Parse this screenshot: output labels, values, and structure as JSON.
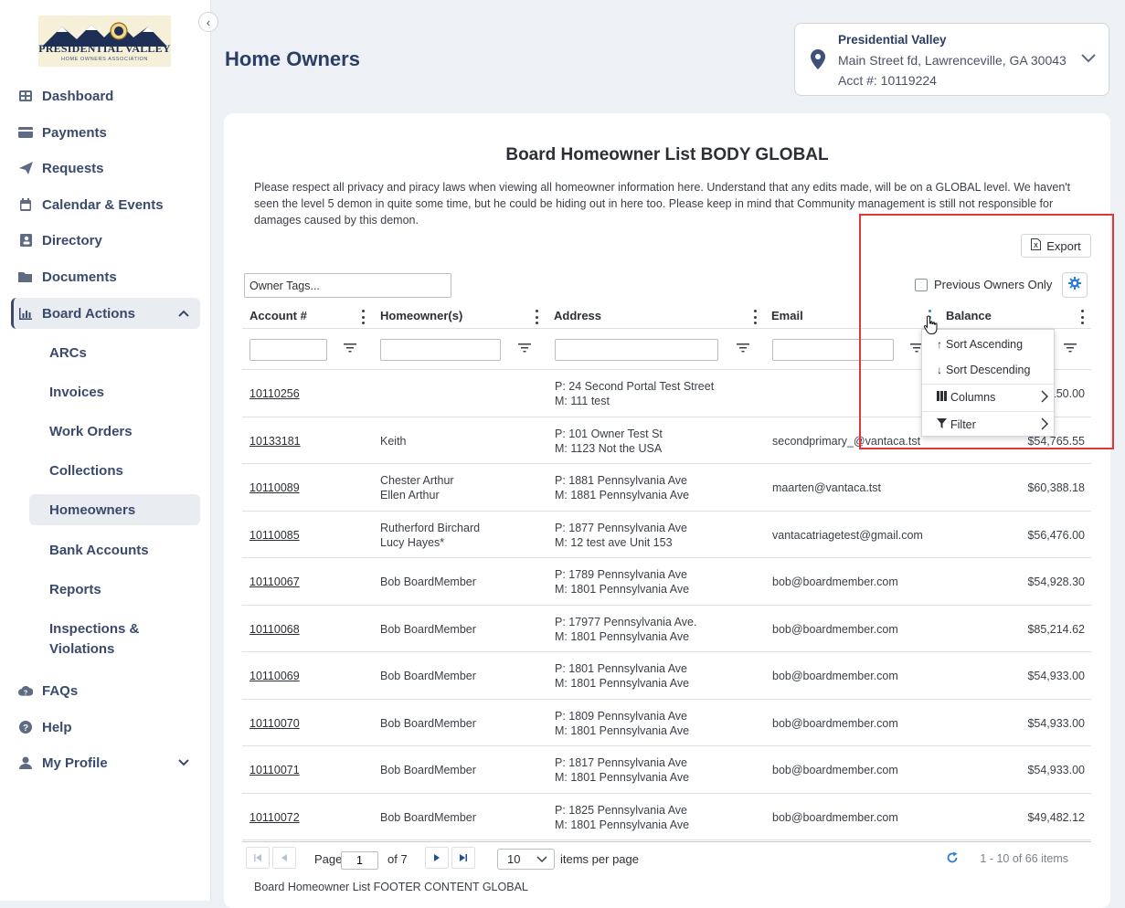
{
  "logo": {
    "title": "PRESIDENTIAL VALLEY",
    "subtitle": "HOME OWNERS ASSOCIATION"
  },
  "sidebar": {
    "items": [
      {
        "label": "Dashboard",
        "icon": "dashboard-icon"
      },
      {
        "label": "Payments",
        "icon": "credit-card-icon"
      },
      {
        "label": "Requests",
        "icon": "paper-plane-icon"
      },
      {
        "label": "Calendar & Events",
        "icon": "calendar-icon"
      },
      {
        "label": "Directory",
        "icon": "address-book-icon"
      },
      {
        "label": "Documents",
        "icon": "folder-icon"
      },
      {
        "label": "Board Actions",
        "icon": "bar-chart-icon"
      }
    ],
    "board_sub": [
      {
        "label": "ARCs"
      },
      {
        "label": "Invoices"
      },
      {
        "label": "Work Orders"
      },
      {
        "label": "Collections"
      },
      {
        "label": "Homeowners"
      },
      {
        "label": "Bank Accounts"
      },
      {
        "label": "Reports"
      },
      {
        "label": "Inspections & Violations"
      }
    ],
    "bottom": [
      {
        "label": "FAQs",
        "icon": "cloud-question-icon"
      },
      {
        "label": "Help",
        "icon": "help-circle-icon"
      },
      {
        "label": "My Profile",
        "icon": "user-icon"
      }
    ]
  },
  "header": {
    "title": "Home Owners",
    "assoc_name": "Presidential Valley",
    "assoc_address": "Main Street fd, Lawrenceville, GA 30043",
    "assoc_acct": "Acct #: 10119224"
  },
  "main": {
    "title": "Board Homeowner List BODY GLOBAL",
    "notice": "Please respect all privacy and piracy laws when viewing all homeowner information here. Understand that any edits made, will be on a GLOBAL level. We haven't seen the level 5 demon in quite some time, but he could be hiding out in here too. Please keep in mind that Community management is still not responsible for damages caused by this demon.",
    "export_label": "Export",
    "owner_tags_placeholder": "Owner Tags...",
    "prev_owners_label": "Previous Owners Only",
    "columns": [
      "Account #",
      "Homeowner(s)",
      "Address",
      "Email",
      "Balance"
    ],
    "rows": [
      {
        "acct": "10110256",
        "owner1": "",
        "owner2": "",
        "addr_p": "P: 24 Second Portal Test Street",
        "addr_m": "M: 111 test",
        "email": "",
        "balance": "$150.00"
      },
      {
        "acct": "10133181",
        "owner1": "Keith",
        "owner2": "",
        "addr_p": "P: 101 Owner Test St",
        "addr_m": "M: 1123 Not the USA",
        "email": "secondprimary_@vantaca.tst",
        "balance": "$54,765.55"
      },
      {
        "acct": "10110089",
        "owner1": "Chester Arthur",
        "owner2": "Ellen Arthur",
        "addr_p": "P: 1881 Pennsylvania Ave",
        "addr_m": "M: 1881 Pennsylvania Ave",
        "email": "maarten@vantaca.tst",
        "balance": "$60,388.18"
      },
      {
        "acct": "10110085",
        "owner1": "Rutherford Birchard",
        "owner2": "Lucy Hayes*",
        "addr_p": "P: 1877 Pennsylvania Ave",
        "addr_m": "M: 12 test ave Unit 153",
        "email": "vantacatriagetest@gmail.com",
        "balance": "$56,476.00"
      },
      {
        "acct": "10110067",
        "owner1": "Bob BoardMember",
        "owner2": "",
        "addr_p": "P: 1789 Pennsylvania Ave",
        "addr_m": "M: 1801 Pennsylvania Ave",
        "email": "bob@boardmember.com",
        "balance": "$54,928.30"
      },
      {
        "acct": "10110068",
        "owner1": "Bob BoardMember",
        "owner2": "",
        "addr_p": "P: 17977 Pennsylvania Ave.",
        "addr_m": "M: 1801 Pennsylvania Ave",
        "email": "bob@boardmember.com",
        "balance": "$85,214.62"
      },
      {
        "acct": "10110069",
        "owner1": "Bob BoardMember",
        "owner2": "",
        "addr_p": "P: 1801 Pennsylvania Ave",
        "addr_m": "M: 1801 Pennsylvania Ave",
        "email": "bob@boardmember.com",
        "balance": "$54,933.00"
      },
      {
        "acct": "10110070",
        "owner1": "Bob BoardMember",
        "owner2": "",
        "addr_p": "P: 1809 Pennsylvania Ave",
        "addr_m": "M: 1801 Pennsylvania Ave",
        "email": "bob@boardmember.com",
        "balance": "$54,933.00"
      },
      {
        "acct": "10110071",
        "owner1": "Bob BoardMember",
        "owner2": "",
        "addr_p": "P: 1817 Pennsylvania Ave",
        "addr_m": "M: 1801 Pennsylvania Ave",
        "email": "bob@boardmember.com",
        "balance": "$54,933.00"
      },
      {
        "acct": "10110072",
        "owner1": "Bob BoardMember",
        "owner2": "",
        "addr_p": "P: 1825 Pennsylvania Ave",
        "addr_m": "M: 1801 Pennsylvania Ave",
        "email": "bob@boardmember.com",
        "balance": "$49,482.12"
      }
    ],
    "pager": {
      "page_label": "Page",
      "page_value": "1",
      "of_label": "of 7",
      "page_size": "10",
      "items_per_page": "items per page",
      "info": "1 - 10 of 66 items"
    },
    "footer": "Board Homeowner List FOOTER CONTENT GLOBAL"
  },
  "column_menu": {
    "sort_asc": "Sort Ascending",
    "sort_desc": "Sort Descending",
    "columns": "Columns",
    "filter": "Filter"
  },
  "colors": {
    "accent": "#2c3e63",
    "highlight": "#e0383a",
    "link_blue": "#2e7cd6"
  }
}
